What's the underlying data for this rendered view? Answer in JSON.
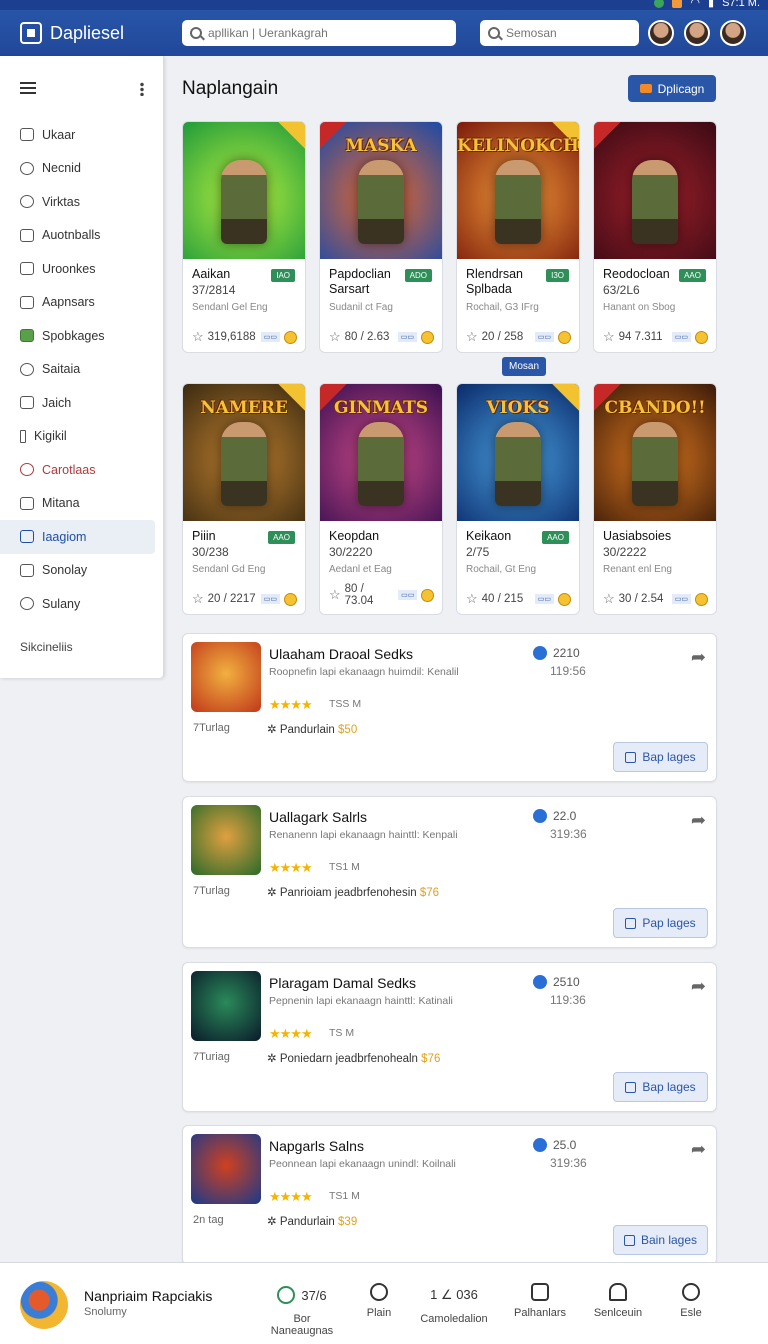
{
  "status": {
    "time": "S7:1 M."
  },
  "app": {
    "title": "Dapliesel"
  },
  "search": {
    "main_placeholder": "apllikan | Uerankagrah",
    "secondary_placeholder": "Semosan"
  },
  "sidebar": {
    "items": [
      {
        "label": "Ukaar",
        "icon": "home-icon"
      },
      {
        "label": "Necnid",
        "icon": "user-icon"
      },
      {
        "label": "Virktas",
        "icon": "cloud-icon"
      },
      {
        "label": "Auotnballs",
        "icon": "list-icon"
      },
      {
        "label": "Uroonkes",
        "icon": "square-icon"
      },
      {
        "label": "Aapnsars",
        "icon": "edit-icon"
      },
      {
        "label": "Spobkages",
        "icon": "android-icon"
      },
      {
        "label": "Saitaia",
        "icon": "globe-icon"
      },
      {
        "label": "Jaich",
        "icon": "grid-icon"
      },
      {
        "label": "Kigikil",
        "icon": "tag-icon"
      },
      {
        "label": "Carotlaas",
        "icon": "people-icon"
      },
      {
        "label": "Mitana",
        "icon": "doc-icon"
      },
      {
        "label": "Iaagiom",
        "icon": "image-icon"
      },
      {
        "label": "Sonolay",
        "icon": "chart-icon"
      },
      {
        "label": "Sulany",
        "icon": "circle-icon"
      }
    ],
    "footer": "Sikcineliis"
  },
  "main": {
    "title": "Naplangain",
    "primary_button": "Dplicagn",
    "tooltip": "Mosan"
  },
  "cards": [
    {
      "title": "",
      "name": "Aaikan",
      "num": "37/2814",
      "badge": "IAO",
      "sub": "Sendanl Gel Eng",
      "rating": "319,6188",
      "bg": "#1f9a3a,#b8f040"
    },
    {
      "title": "MASKA",
      "name": "Papdoclian Sarsart",
      "num": "",
      "badge": "ADO",
      "sub": "Sudanil ct Fag",
      "rating": "80 / 2.63",
      "bg": "#1a4aa8,#f06a2a"
    },
    {
      "title": "KELINOKCH",
      "name": "Rlendrsan Splbada",
      "num": "",
      "badge": "I3O",
      "sub": "Rochail, G3 IFrg",
      "rating": "20 / 258",
      "bg": "#7a1a0a,#f29a3a"
    },
    {
      "title": "",
      "name": "Reodocloan",
      "num": "63/2L6",
      "badge": "AAO",
      "sub": "Hanant on Sbog",
      "rating": "94 7.311",
      "bg": "#3a0a14,#a0202a"
    },
    {
      "title": "NAMERE",
      "name": "Piiin",
      "num": "30/238",
      "badge": "AAO",
      "sub": "Sendanl Gd Eng",
      "rating": "20 / 2217",
      "bg": "#3a2a10,#c08030"
    },
    {
      "title": "GINMATS",
      "name": "Keopdan",
      "num": "30/2220",
      "badge": "",
      "sub": "Aedanl et Eag",
      "rating": "80 / 73.04",
      "bg": "#3a1050,#d04a8a"
    },
    {
      "title": "VIOKS",
      "name": "Keikaon",
      "num": "2/75",
      "badge": "AAO",
      "sub": "Rochail, Gt Eng",
      "rating": "40 / 215",
      "bg": "#0a2a6a,#4aa0e0"
    },
    {
      "title": "CBANDO!!",
      "name": "Uasiabsoies",
      "num": "30/2222",
      "badge": "",
      "sub": "Renant enl Eng",
      "rating": "30 / 2.54",
      "bg": "#3a1a08,#e07a20"
    }
  ],
  "list": [
    {
      "title": "Ulaaham Draoal Sedks",
      "desc": "Roopnefin lapi ekanaagn huimdil: Kenalil",
      "size": "TSS M",
      "cat": "7Turlag",
      "price_label": "Pandurlain",
      "price": "$50",
      "dl": "2210",
      "time": "119:56",
      "button": "Bap lages",
      "thumb": "#c0381a,#f2b040"
    },
    {
      "title": "Uallagark Salrls",
      "desc": "Renanenn lapi ekanaagn hainttl: Kenpali",
      "size": "TS1 M",
      "cat": "7Turlag",
      "price_label": "Panrioiam jeadbrfenohesin",
      "price": "$76",
      "dl": "22.0",
      "time": "319:36",
      "button": "Pap lages",
      "thumb": "#2a6a2a,#e0a040"
    },
    {
      "title": "Plaragam Damal Sedks",
      "desc": "Pepnenin lapi ekanaagn hainttl: Katinali",
      "size": "TS M",
      "cat": "7Turiag",
      "price_label": "Poniedarn jeadbrfenohealn",
      "price": "$76",
      "dl": "2510",
      "time": "119:36",
      "button": "Bap lages",
      "thumb": "#0a1a2a,#2a8a5a"
    },
    {
      "title": "Napgarls Salns",
      "desc": "Peonnean lapi ekanaagn unindl: Koilnali",
      "size": "TS1 M",
      "cat": "2n tag",
      "price_label": "Pandurlain",
      "price": "$39",
      "dl": "25.0",
      "time": "319:36",
      "button": "Bain lages",
      "thumb": "#1a3a8a,#d04020"
    }
  ],
  "bottom": {
    "app_name": "Nanpriaim Rapciakis",
    "app_sub": "Snolumy",
    "items": [
      {
        "label": "Bor Naneaugnas",
        "value": "37/6",
        "icon": "refresh-icon"
      },
      {
        "label": "Plain",
        "value": "",
        "icon": "info-icon"
      },
      {
        "label": "Camoledalion",
        "value": "1 ∠ 036",
        "icon": "edit-icon"
      },
      {
        "label": "Palhanlars",
        "value": "",
        "icon": "box-icon"
      },
      {
        "label": "Senlceuin",
        "value": "",
        "icon": "bell-icon"
      },
      {
        "label": "Esle",
        "value": "",
        "icon": "person-icon"
      }
    ]
  }
}
